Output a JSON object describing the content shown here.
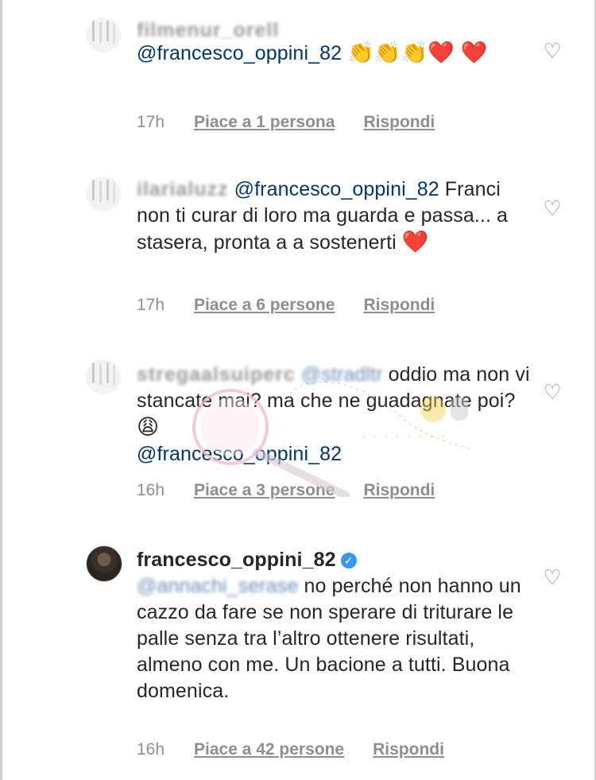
{
  "comments": [
    {
      "username": "filmenur_orell",
      "mention": "@francesco_oppini_82",
      "text_after": "",
      "emoji": "👏👏👏❤️ ❤️",
      "time": "17h",
      "likes": "Piace a 1 persona",
      "reply": "Rispondi"
    },
    {
      "username": "ilarialuzz",
      "mention": "@francesco_oppini_82",
      "text": "Franci non ti curar di loro ma guarda e passa... a stasera, pronta a a sostenerti",
      "emoji": "❤️",
      "time": "17h",
      "likes": "Piace a 6 persone",
      "reply": "Rispondi"
    },
    {
      "username": "stregaalsuiperc",
      "mention_blur": "@stradltr",
      "text": "oddio ma non vi stancate mai? ma che ne guadagnate poi?",
      "emoji": "😩",
      "mention": "@francesco_oppini_82",
      "time": "16h",
      "likes": "Piace a 3 persone",
      "reply": "Rispondi"
    },
    {
      "username": "francesco_oppini_82",
      "verified": true,
      "mention_blur": "@annachi_serase",
      "text": "no perché non hanno un cazzo da fare se non sperare di triturare le palle senza tra l’altro ottenere risultati, almeno con me. Un bacione a tutti. Buona domenica.",
      "time": "16h",
      "likes": "Piace a 42 persone",
      "reply": "Rispondi"
    }
  ],
  "icons": {
    "like": "heart-outline-icon",
    "verified": "verified-badge-icon"
  },
  "colors": {
    "text": "#262626",
    "meta": "#8e8e8e",
    "mention": "#00376b",
    "verified": "#3897f0"
  }
}
